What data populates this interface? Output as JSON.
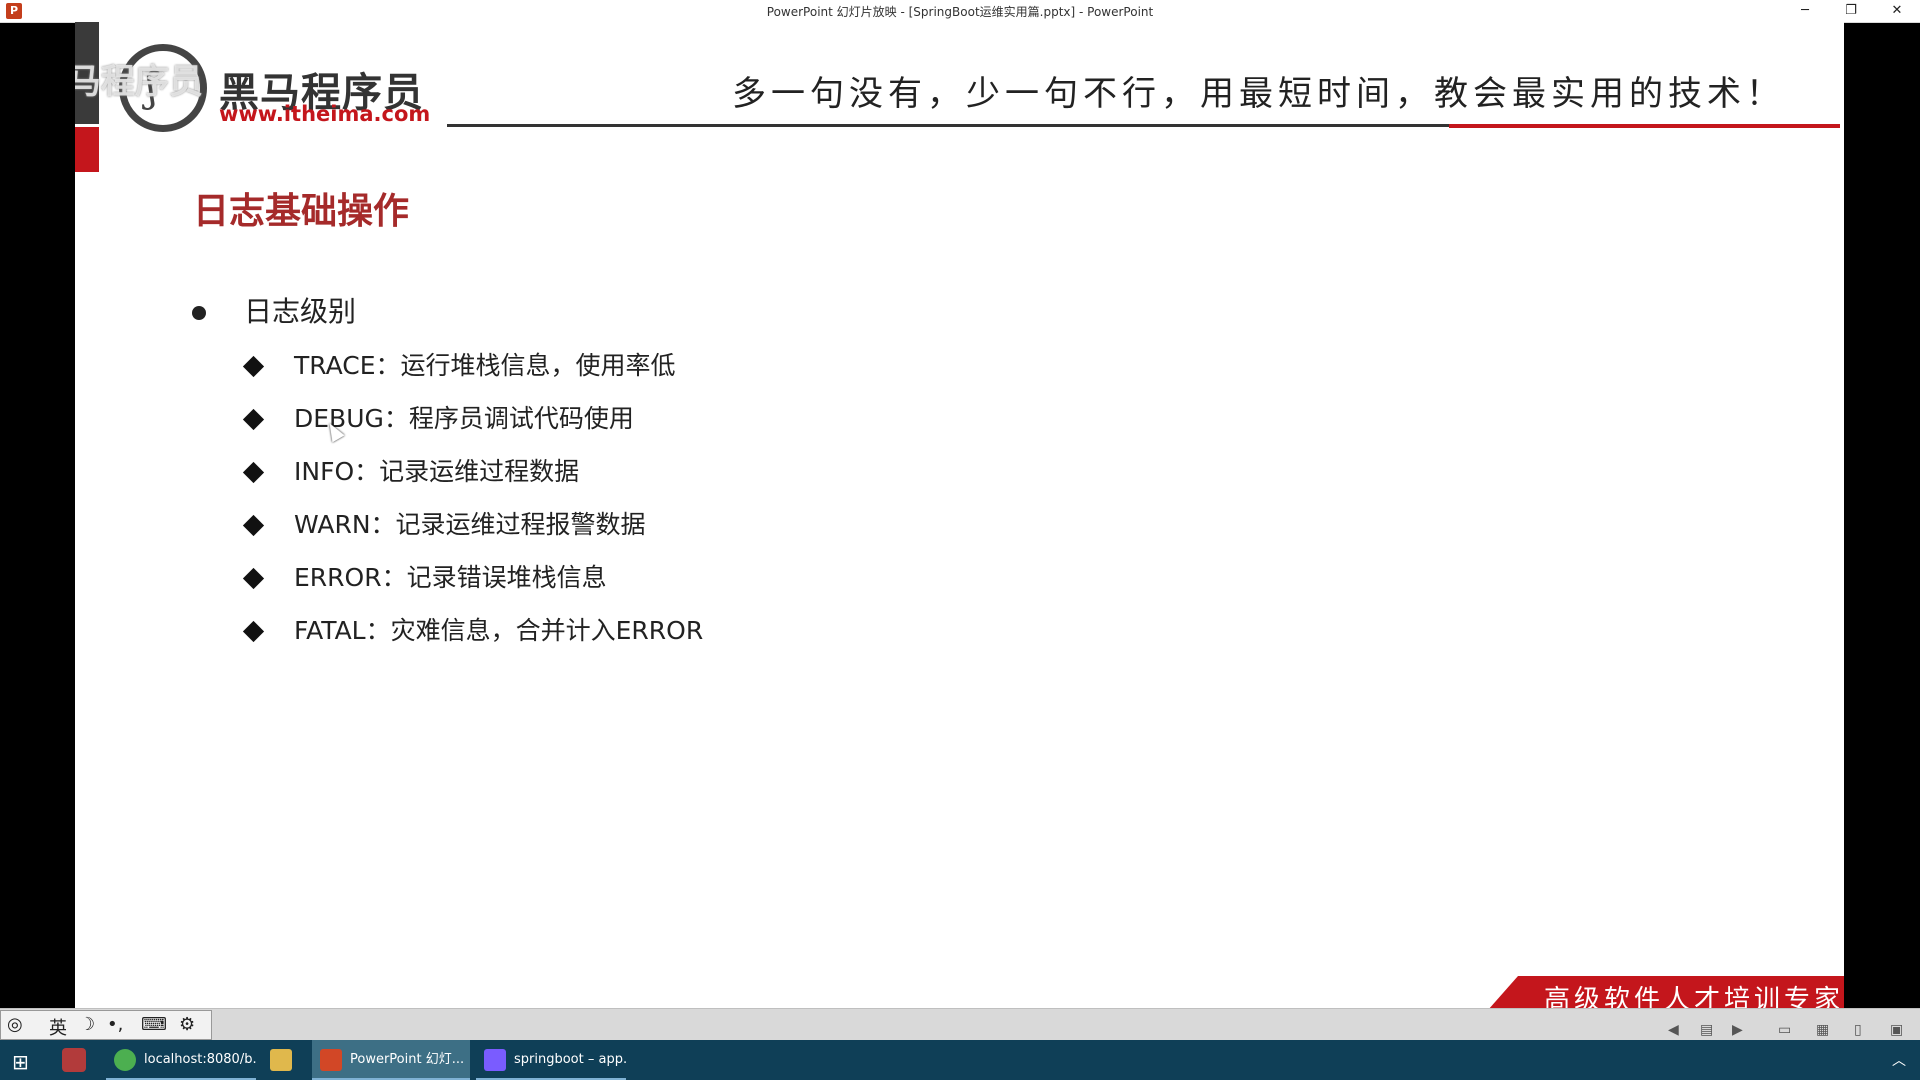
{
  "window": {
    "title": "PowerPoint 幻灯片放映 - [SpringBoot运维实用篇.pptx] - PowerPoint",
    "app_icon_letter": "P",
    "minimize_glyph": "─",
    "restore_glyph": "❐",
    "close_glyph": "✕"
  },
  "slide": {
    "logo": {
      "name": "黑马程序员",
      "url": "www.itheima.com",
      "watermark": "黑马程序员"
    },
    "slogan": "多一句没有，少一句不行，用最短时间，教会最实用的技术！",
    "heading": "日志基础操作",
    "bullet": "日志级别",
    "levels": [
      "TRACE：运行堆栈信息，使用率低",
      "DEBUG：程序员调试代码使用",
      "INFO：记录运维过程数据",
      "WARN：记录运维过程报警数据",
      "ERROR：记录错误堆栈信息",
      "FATAL：灾难信息，合并计入ERROR"
    ],
    "footer": "高级软件人才培训专家"
  },
  "ime": {
    "lang": "英",
    "moon": "☽",
    "punct": "•,",
    "keyboard": "⌨",
    "settings": "⚙"
  },
  "slideshow_controls": {
    "prev": "◀",
    "notes": "▤",
    "next": "▶",
    "normal": "▭",
    "sorter": "▦",
    "reading": "▯",
    "slideshow": "▣"
  },
  "taskbar": {
    "start_glyph": "⊞",
    "items": [
      {
        "label": "localhost:8080/b...",
        "color": "#4caf50"
      },
      {
        "label": "",
        "color": "#e0b84c"
      },
      {
        "label": "PowerPoint 幻灯...",
        "color": "#d24726"
      },
      {
        "label": "springboot – app...",
        "color": "#7a5cff"
      }
    ],
    "tray_glyph": "︿"
  }
}
